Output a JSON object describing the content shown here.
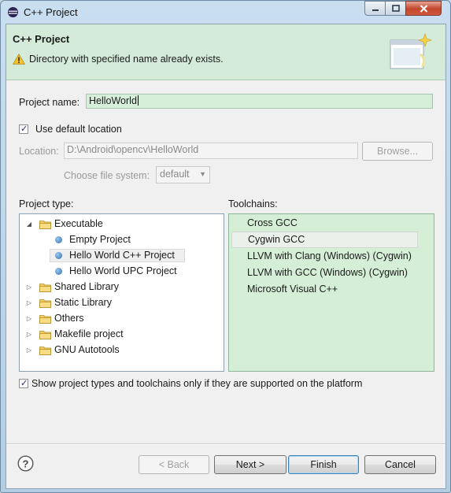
{
  "window": {
    "title": "C++ Project"
  },
  "header": {
    "title": "C++ Project",
    "message": "Directory with specified name already exists."
  },
  "project_name": {
    "label": "Project name:",
    "value": "HelloWorld"
  },
  "use_default_location": {
    "label": "Use default location",
    "checked": true
  },
  "location": {
    "label": "Location:",
    "value": "D:\\Android\\opencv\\HelloWorld",
    "browse_label": "Browse..."
  },
  "file_system": {
    "label": "Choose file system:",
    "value": "default"
  },
  "project_type": {
    "label": "Project type:",
    "items": [
      {
        "label": "Executable",
        "kind": "folder",
        "expanded": true
      },
      {
        "label": "Empty Project",
        "kind": "leaf"
      },
      {
        "label": "Hello World C++ Project",
        "kind": "leaf",
        "selected": true
      },
      {
        "label": "Hello World UPC Project",
        "kind": "leaf"
      },
      {
        "label": "Shared Library",
        "kind": "folder",
        "expanded": false
      },
      {
        "label": "Static Library",
        "kind": "folder",
        "expanded": false
      },
      {
        "label": "Others",
        "kind": "folder",
        "expanded": false
      },
      {
        "label": "Makefile project",
        "kind": "folder",
        "expanded": false
      },
      {
        "label": "GNU Autotools",
        "kind": "folder",
        "expanded": false
      }
    ]
  },
  "toolchains": {
    "label": "Toolchains:",
    "items": [
      {
        "label": "Cross GCC"
      },
      {
        "label": "Cygwin GCC",
        "selected": true
      },
      {
        "label": "LLVM with Clang (Windows) (Cygwin)"
      },
      {
        "label": "LLVM with GCC (Windows) (Cygwin)"
      },
      {
        "label": "Microsoft Visual C++"
      }
    ]
  },
  "platform_filter": {
    "label": "Show project types and toolchains only if they are supported on the platform",
    "checked": true
  },
  "buttons": {
    "back": "< Back",
    "next": "Next >",
    "finish": "Finish",
    "cancel": "Cancel"
  },
  "icons": {
    "window_icon": "eclipse-icon",
    "warning_icon": "warning-icon",
    "help_icon": "help-icon",
    "folder_icon": "folder-icon",
    "bullet_icon": "bullet-icon"
  },
  "colors": {
    "header_bg": "#d3ebd8",
    "toolchain_bg": "#d4efd6",
    "input_bg": "#d6efd9"
  }
}
